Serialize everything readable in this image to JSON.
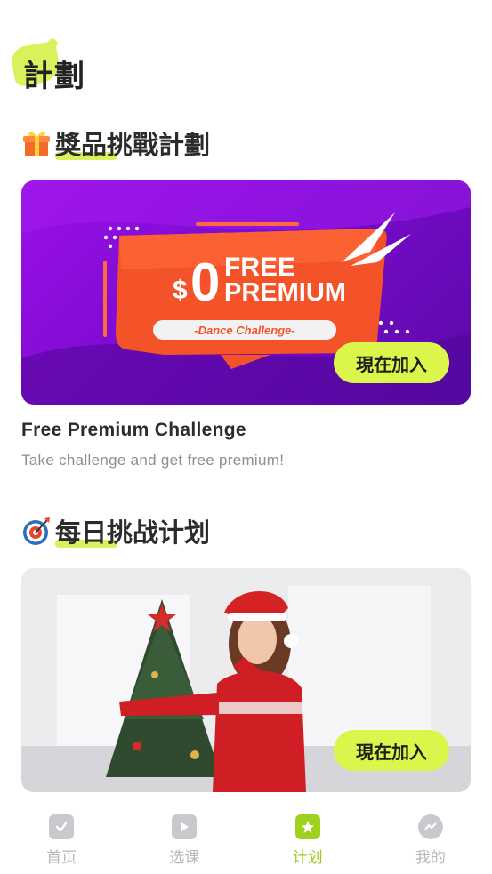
{
  "page": {
    "title": "計劃"
  },
  "sections": [
    {
      "title": "獎品挑戰計劃",
      "emoji": "gift-icon",
      "card": {
        "join_label": "現在加入",
        "banner": {
          "price": "$0",
          "line1": "FREE",
          "line2": "PREMIUM",
          "tag": "-Dance Challenge-"
        },
        "heading": "Free Premium Challenge",
        "subtitle": "Take challenge and get free premium!"
      }
    },
    {
      "title": "每日挑战计划",
      "emoji": "target-icon",
      "card": {
        "join_label": "現在加入"
      }
    }
  ],
  "bottom_nav": [
    {
      "label": "首页",
      "icon": "calendar-icon",
      "active": false
    },
    {
      "label": "选课",
      "icon": "play-icon",
      "active": false
    },
    {
      "label": "计划",
      "icon": "star-icon",
      "active": true
    },
    {
      "label": "我的",
      "icon": "messenger-icon",
      "active": false
    }
  ],
  "colors": {
    "accent": "#d7f25a",
    "accent_dark": "#9fd21f",
    "banner_purple": "#8a0fdc",
    "banner_orange": "#f2562b"
  }
}
